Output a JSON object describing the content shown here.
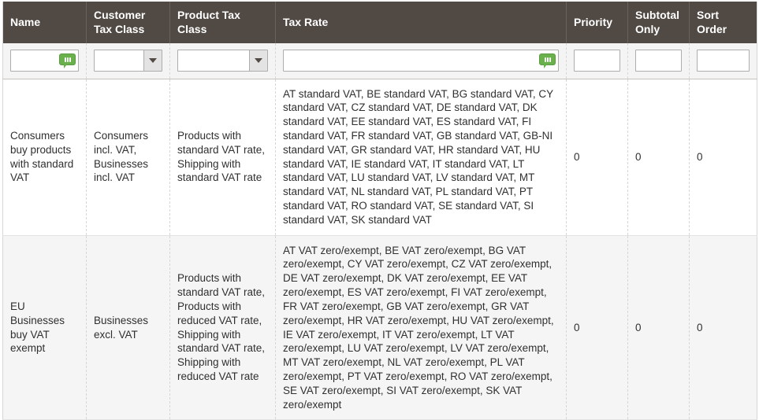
{
  "table": {
    "columns": [
      {
        "key": "name",
        "label": "Name"
      },
      {
        "key": "customer_tax_class",
        "label": "Customer\nTax Class"
      },
      {
        "key": "product_tax_class",
        "label": "Product Tax Class"
      },
      {
        "key": "tax_rate",
        "label": "Tax Rate"
      },
      {
        "key": "priority",
        "label": "Priority"
      },
      {
        "key": "subtotal_only",
        "label": "Subtotal\nOnly"
      },
      {
        "key": "sort_order",
        "label": "Sort\nOrder"
      }
    ],
    "filters": {
      "name": {
        "type": "text",
        "value": "",
        "placeholder": "",
        "icon": "autofill-bubble-icon"
      },
      "customer_tax_class": {
        "type": "select",
        "value": "",
        "icon": "chevron-down-icon"
      },
      "product_tax_class": {
        "type": "select",
        "value": "",
        "icon": "chevron-down-icon"
      },
      "tax_rate": {
        "type": "text",
        "value": "",
        "placeholder": "",
        "icon": "autofill-bubble-icon"
      },
      "priority": {
        "type": "text",
        "value": "",
        "placeholder": ""
      },
      "subtotal_only": {
        "type": "text",
        "value": "",
        "placeholder": ""
      },
      "sort_order": {
        "type": "text",
        "value": "",
        "placeholder": ""
      }
    },
    "rows": [
      {
        "name": "Consumers buy products with standard VAT",
        "customer_tax_class": "Consumers incl. VAT, Businesses incl. VAT",
        "product_tax_class": "Products with standard VAT rate, Shipping with standard VAT rate",
        "tax_rate": "AT standard VAT, BE standard VAT, BG standard VAT, CY standard VAT, CZ standard VAT, DE standard VAT, DK standard VAT, EE standard VAT, ES standard VAT, FI standard VAT, FR standard VAT, GB standard VAT, GB-NI standard VAT, GR standard VAT, HR standard VAT, HU standard VAT, IE standard VAT, IT standard VAT, LT standard VAT, LU standard VAT, LV standard VAT, MT standard VAT, NL standard VAT, PL standard VAT, PT standard VAT, RO standard VAT, SE standard VAT, SI standard VAT, SK standard VAT",
        "priority": "0",
        "subtotal_only": "0",
        "sort_order": "0"
      },
      {
        "name": "EU Businesses buy VAT exempt",
        "customer_tax_class": "Businesses excl. VAT",
        "product_tax_class": "Products with standard VAT rate, Products with reduced VAT rate, Shipping with standard VAT rate, Shipping with reduced VAT rate",
        "tax_rate": "AT VAT zero/exempt, BE VAT zero/exempt, BG VAT zero/exempt, CY VAT zero/exempt, CZ VAT zero/exempt, DE VAT zero/exempt, DK VAT zero/exempt, EE VAT zero/exempt, ES VAT zero/exempt, FI VAT zero/exempt, FR VAT zero/exempt, GB VAT zero/exempt, GR VAT zero/exempt, HR VAT zero/exempt, HU VAT zero/exempt, IE VAT zero/exempt, IT VAT zero/exempt, LT VAT zero/exempt, LU VAT zero/exempt, LV VAT zero/exempt, MT VAT zero/exempt, NL VAT zero/exempt, PL VAT zero/exempt, PT VAT zero/exempt, RO VAT zero/exempt, SE VAT zero/exempt, SI VAT zero/exempt, SK VAT zero/exempt",
        "priority": "0",
        "subtotal_only": "0",
        "sort_order": "0"
      }
    ]
  },
  "colors": {
    "header_bg": "#514943",
    "header_text": "#ffffff",
    "row_alt_bg": "#f5f5f5",
    "filter_bg": "#f4f4f4",
    "autofill_green": "#6ab04c",
    "body_text": "#303030"
  }
}
